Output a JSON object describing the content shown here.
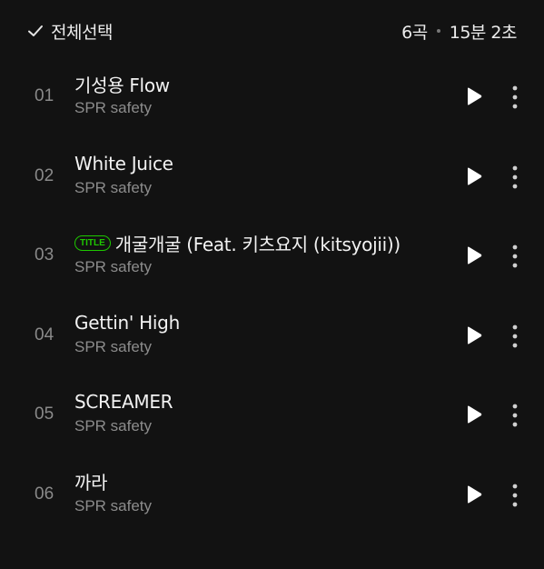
{
  "header": {
    "select_all_label": "전체선택",
    "track_count": "6곡",
    "total_duration": "15분 2초"
  },
  "tracks": [
    {
      "number": "01",
      "title": "기성용 Flow",
      "artist": "SPR safety",
      "is_title": false,
      "badge": ""
    },
    {
      "number": "02",
      "title": "White Juice",
      "artist": "SPR safety",
      "is_title": false,
      "badge": ""
    },
    {
      "number": "03",
      "title": "개굴개굴 (Feat. 키츠요지 (kitsyojii))",
      "artist": "SPR safety",
      "is_title": true,
      "badge": "TITLE"
    },
    {
      "number": "04",
      "title": "Gettin' High",
      "artist": "SPR safety",
      "is_title": false,
      "badge": ""
    },
    {
      "number": "05",
      "title": "SCREAMER",
      "artist": "SPR safety",
      "is_title": false,
      "badge": ""
    },
    {
      "number": "06",
      "title": "까라",
      "artist": "SPR safety",
      "is_title": false,
      "badge": ""
    }
  ],
  "icons": {
    "select_all": "check-icon",
    "play": "play-icon",
    "more": "more-vertical-icon"
  },
  "colors": {
    "background": "#121212",
    "title_badge": "#1ec800",
    "primary_text": "#f2f2f2",
    "secondary_text": "#8c8c8c"
  }
}
